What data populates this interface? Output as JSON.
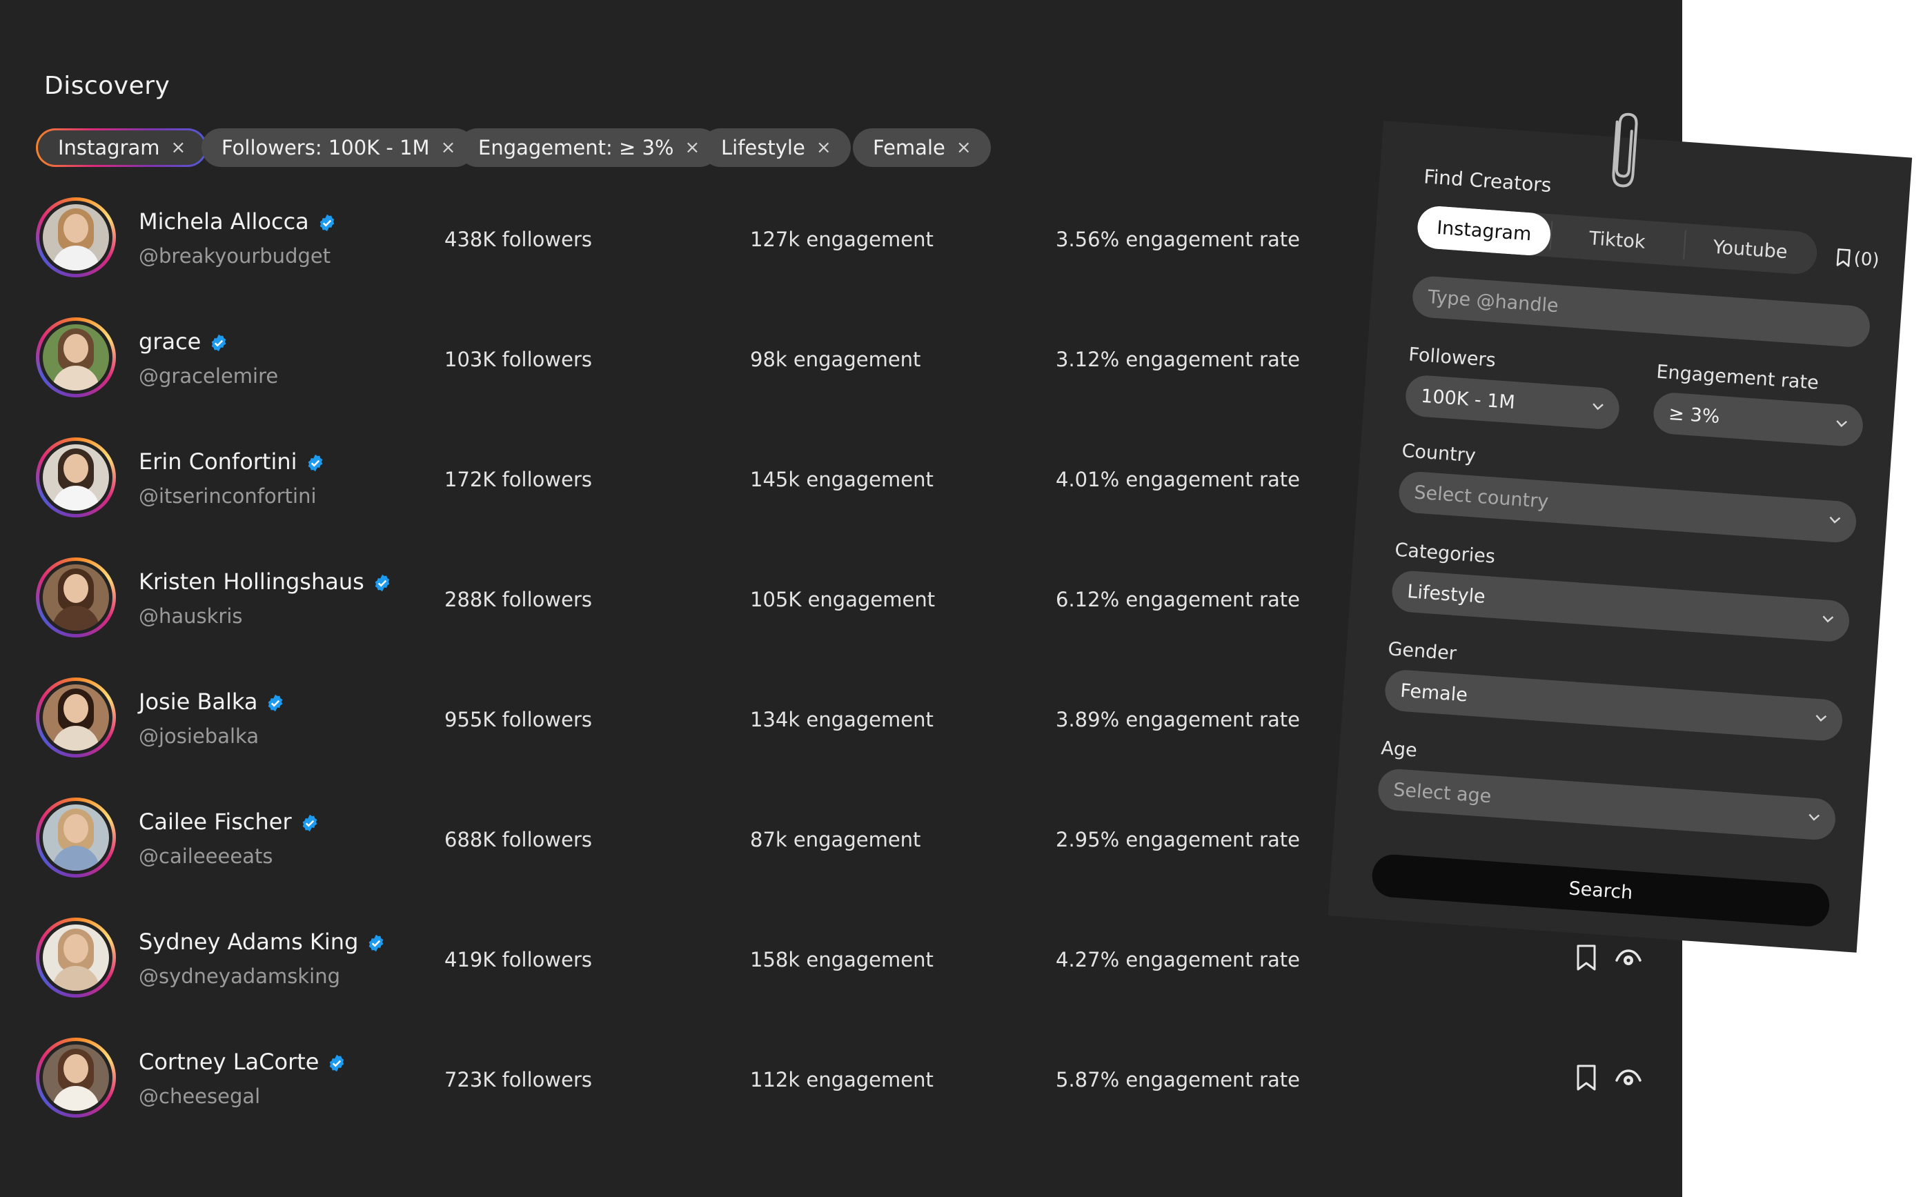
{
  "page": {
    "title": "Discovery"
  },
  "chips": [
    {
      "label": "Instagram",
      "remove": "×"
    },
    {
      "label": "Followers: 100K - 1M",
      "remove": "×"
    },
    {
      "label": "Engagement: ≥ 3%",
      "remove": "×"
    },
    {
      "label": "Lifestyle",
      "remove": "×"
    },
    {
      "label": "Female",
      "remove": "×"
    }
  ],
  "creators": [
    {
      "name": "Michela Allocca",
      "handle": "@breakyourbudget",
      "followers": "438K followers",
      "engagement": "127k engagement",
      "rate": "3.56% engagement rate"
    },
    {
      "name": "grace",
      "handle": "@gracelemire",
      "followers": "103K followers",
      "engagement": "98k engagement",
      "rate": "3.12% engagement rate"
    },
    {
      "name": "Erin Confortini",
      "handle": "@itserinconfortini",
      "followers": "172K followers",
      "engagement": "145k engagement",
      "rate": "4.01% engagement rate"
    },
    {
      "name": "Kristen Hollingshaus",
      "handle": "@hauskris",
      "followers": "288K followers",
      "engagement": "105K engagement",
      "rate": "6.12% engagement rate"
    },
    {
      "name": "Josie Balka",
      "handle": "@josiebalka",
      "followers": "955K followers",
      "engagement": "134k engagement",
      "rate": "3.89% engagement rate"
    },
    {
      "name": "Cailee Fischer",
      "handle": "@caileeeeats",
      "followers": "688K followers",
      "engagement": "87k engagement",
      "rate": "2.95% engagement rate"
    },
    {
      "name": "Sydney Adams King",
      "handle": "@sydneyadamsking",
      "followers": "419K followers",
      "engagement": "158k engagement",
      "rate": "4.27% engagement rate"
    },
    {
      "name": "Cortney LaCorte",
      "handle": "@cheesegal",
      "followers": "723K followers",
      "engagement": "112k engagement",
      "rate": "5.87% engagement rate"
    }
  ],
  "filter_card": {
    "title": "Find Creators",
    "tabs": [
      "Instagram",
      "Tiktok",
      "Youtube"
    ],
    "active_tab": "Instagram",
    "saved_count": "(0)",
    "handle_placeholder": "Type @handle",
    "followers_label": "Followers",
    "followers_value": "100K - 1M",
    "engagement_label": "Engagement rate",
    "engagement_value": "≥ 3%",
    "country_label": "Country",
    "country_placeholder": "Select country",
    "categories_label": "Categories",
    "categories_value": "Lifestyle",
    "gender_label": "Gender",
    "gender_value": "Female",
    "age_label": "Age",
    "age_placeholder": "Select age",
    "search_label": "Search"
  },
  "colors": {
    "background": "#232323",
    "card": "#2a2a2a",
    "chip": "#4a4a4a",
    "verified": "#1d9bf0",
    "handle_text": "#9a9a9a"
  },
  "icons": {
    "verified": "verified-badge-icon",
    "remove": "close-icon",
    "bookmark": "bookmark-icon",
    "eye": "eye-icon",
    "chevron": "chevron-down-icon",
    "clip": "paperclip-icon"
  }
}
